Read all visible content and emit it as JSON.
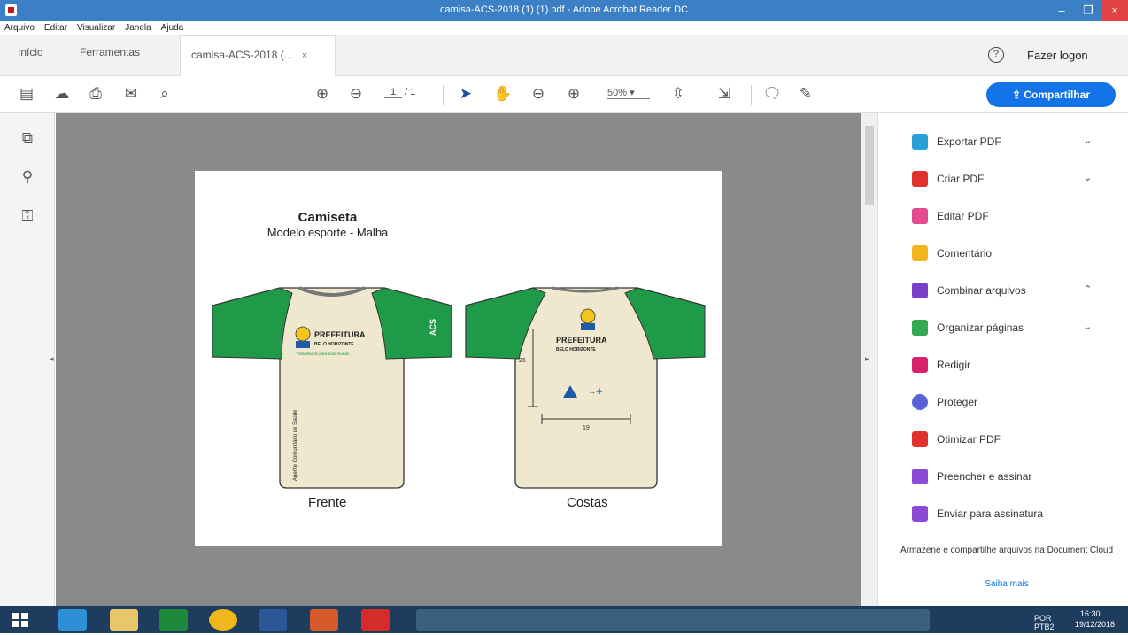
{
  "window": {
    "title": "camisa-ACS-2018 (1) (1).pdf - Adobe Acrobat Reader DC"
  },
  "menu": [
    "Arquivo",
    "Editar",
    "Visualizar",
    "Janela",
    "Ajuda"
  ],
  "tabs": {
    "home": "Início",
    "tools": "Ferramentas",
    "document": "camisa-ACS-2018 (...",
    "close": "×"
  },
  "header": {
    "signin": "Fazer logon",
    "share": "Compartilhar"
  },
  "toolbar": {
    "page_current": "1",
    "page_total": "/ 1",
    "zoom": "50%"
  },
  "document": {
    "title": "Camiseta",
    "subtitle": "Modelo esporte - Malha",
    "front_label": "Frente",
    "back_label": "Costas",
    "prefeitura": "PREFEITURA",
    "city": "BELO HORIZONTE",
    "slogan": "Trabalhando para todo mundo",
    "sleeve_text": "ACS",
    "vertical_text": "Agente Comunitário de Saúde",
    "dim_vertical": "26",
    "dim_horizontal": "19"
  },
  "tools": [
    {
      "label": "Exportar PDF",
      "icon": "export-pdf-icon",
      "color": "#2aa1d6",
      "chevron": "⌄"
    },
    {
      "label": "Criar PDF",
      "icon": "create-pdf-icon",
      "color": "#e0312c",
      "chevron": "⌄"
    },
    {
      "label": "Editar PDF",
      "icon": "edit-pdf-icon",
      "color": "#e24b8c",
      "chevron": ""
    },
    {
      "label": "Comentário",
      "icon": "comment-icon",
      "color": "#f2b51d",
      "chevron": ""
    },
    {
      "label": "Combinar arquivos",
      "icon": "combine-icon",
      "color": "#7b3fc9",
      "chevron": "⌃"
    },
    {
      "label": "Organizar páginas",
      "icon": "organize-icon",
      "color": "#34a853",
      "chevron": "⌄"
    },
    {
      "label": "Redigir",
      "icon": "redact-icon",
      "color": "#d6236b",
      "chevron": ""
    },
    {
      "label": "Proteger",
      "icon": "protect-icon",
      "color": "#5a63d6",
      "chevron": ""
    },
    {
      "label": "Otimizar PDF",
      "icon": "optimize-icon",
      "color": "#e0312c",
      "chevron": ""
    },
    {
      "label": "Preencher e assinar",
      "icon": "fill-sign-icon",
      "color": "#8c4bd6",
      "chevron": ""
    },
    {
      "label": "Enviar para assinatura",
      "icon": "send-sign-icon",
      "color": "#8c4bd6",
      "chevron": ""
    }
  ],
  "promo": {
    "text": "Armazene e compartilhe arquivos na Document Cloud",
    "link": "Saiba mais"
  },
  "taskbar": {
    "lang": "POR\nPTB2",
    "time": "16:30",
    "date": "19/12/2018"
  },
  "colors": {
    "accent": "#1473e6",
    "shirt_green": "#1f9a48",
    "shirt_body": "#efe8cf"
  }
}
